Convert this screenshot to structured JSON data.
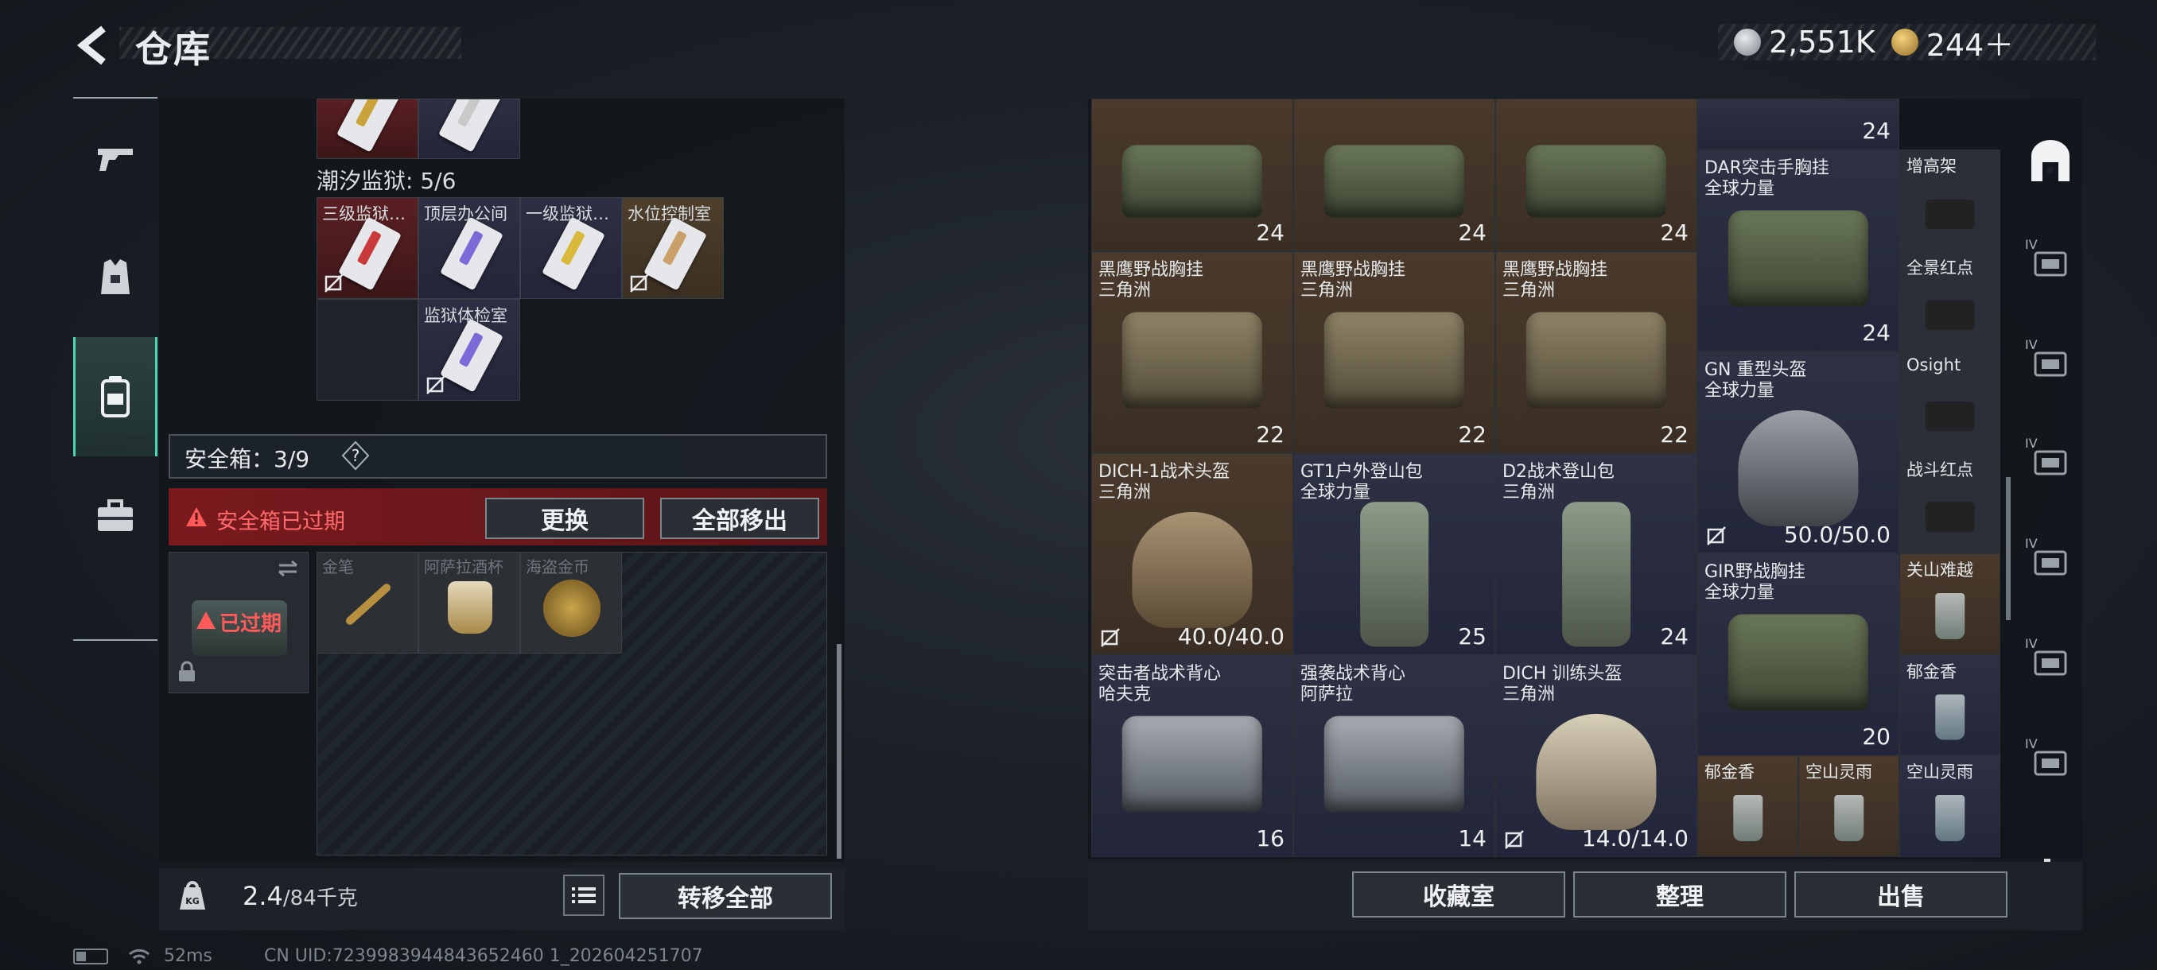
{
  "header": {
    "title": "仓库",
    "currency_silver": "2,551K",
    "currency_gold": "244＋"
  },
  "left": {
    "top_cards": [
      {
        "stripe": "#c9a33a"
      },
      {
        "stripe": "#c9c9c9"
      }
    ],
    "prison_label": "潮汐监狱: 5/6",
    "prison_cards": [
      {
        "label": "三级监狱…",
        "style": "red",
        "stripe": "#c93a3a"
      },
      {
        "label": "顶层办公间",
        "style": "purple",
        "stripe": "#7a6bd8"
      },
      {
        "label": "一级监狱…",
        "style": "purple",
        "stripe": "#d8b93a"
      },
      {
        "label": "水位控制室",
        "style": "gold",
        "stripe": "#c9a06a"
      },
      {
        "label": "监狱体检室",
        "style": "purple",
        "stripe": "#7a6bd8"
      }
    ],
    "safe_label": "安全箱：3/9",
    "help": "?",
    "expired_text": "安全箱已过期",
    "replace_button": "更换",
    "move_all_button": "全部移出",
    "box_expired": "已过期",
    "box_items": [
      "金笔",
      "阿萨拉酒杯",
      "海盗金币"
    ],
    "weight_value": "2.4",
    "weight_capacity": "/84千克",
    "transfer_button": "转移全部"
  },
  "status": {
    "ping": "52ms",
    "uid": "CN UID:7239983944843652460 1_202604251707"
  },
  "right": {
    "items": [
      {
        "n1": "",
        "n2": "",
        "q": "24",
        "bg": "b",
        "kind": "bag-green"
      },
      {
        "n1": "",
        "n2": "",
        "q": "24",
        "bg": "b",
        "kind": "bag-green"
      },
      {
        "n1": "",
        "n2": "",
        "q": "24",
        "bg": "b",
        "kind": "bag-green"
      },
      {
        "n1": "黑鹰野战胸挂",
        "n2": "三角洲",
        "q": "22",
        "bg": "b",
        "kind": "bag-tan"
      },
      {
        "n1": "黑鹰野战胸挂",
        "n2": "三角洲",
        "q": "22",
        "bg": "b",
        "kind": "bag-tan"
      },
      {
        "n1": "黑鹰野战胸挂",
        "n2": "三角洲",
        "q": "22",
        "bg": "b",
        "kind": "bag-tan"
      },
      {
        "n1": "DICH-1战术头盔",
        "n2": "三角洲",
        "q": "40.0/40.0",
        "bg": "b",
        "kind": "helmet-tan"
      },
      {
        "n1": "GT1户外登山包",
        "n2": "全球力量",
        "q": "25",
        "bg": "p",
        "kind": "pack"
      },
      {
        "n1": "D2战术登山包",
        "n2": "三角洲",
        "q": "24",
        "bg": "p",
        "kind": "pack"
      },
      {
        "n1": "突击者战术背心",
        "n2": "哈夫克",
        "q": "16",
        "bg": "p",
        "kind": "bag-grey"
      },
      {
        "n1": "强袭战术背心",
        "n2": "阿萨拉",
        "q": "14",
        "bg": "p",
        "kind": "bag-grey"
      },
      {
        "n1": "DICH 训练头盔",
        "n2": "三角洲",
        "q": "14.0/14.0",
        "bg": "p",
        "kind": "helmet-light"
      },
      {
        "n1": "",
        "n2": "",
        "q": "24",
        "bg": "p",
        "kind": "none"
      },
      {
        "n1": "DAR突击手胸挂",
        "n2": "全球力量",
        "q": "24",
        "bg": "p",
        "kind": "bag-green"
      },
      {
        "n1": "GN 重型头盔",
        "n2": "全球力量",
        "q": "50.0/50.0",
        "bg": "p",
        "kind": "helmet-grey"
      },
      {
        "n1": "GIR野战胸挂",
        "n2": "全球力量",
        "q": "20",
        "bg": "p",
        "kind": "bag-green"
      },
      {
        "n1": "郁金香",
        "n2": "",
        "q": "",
        "bg": "b",
        "kind": "glass"
      },
      {
        "n1": "空山灵雨",
        "n2": "",
        "q": "",
        "bg": "b",
        "kind": "glass"
      },
      {
        "n1": "空山灵雨",
        "n2": "",
        "q": "",
        "bg": "p",
        "kind": "glass"
      },
      {
        "n1": "增高架",
        "n2": "",
        "q": "",
        "bg": "d",
        "kind": "scope"
      },
      {
        "n1": "全景红点",
        "n2": "",
        "q": "",
        "bg": "d",
        "kind": "scope"
      },
      {
        "n1": "Osight",
        "n2": "",
        "q": "",
        "bg": "d",
        "kind": "scope"
      },
      {
        "n1": "战斗红点",
        "n2": "",
        "q": "",
        "bg": "d",
        "kind": "scope"
      },
      {
        "n1": "关山难越",
        "n2": "",
        "q": "",
        "bg": "b",
        "kind": "glass"
      },
      {
        "n1": "郁金香",
        "n2": "",
        "q": "",
        "bg": "p",
        "kind": "glass"
      }
    ],
    "collect_button": "收藏室",
    "sort_button": "整理",
    "sell_button": "出售",
    "side_tab_labels": [
      "IV",
      "IV",
      "IV",
      "IV",
      "IV",
      "IV"
    ]
  }
}
